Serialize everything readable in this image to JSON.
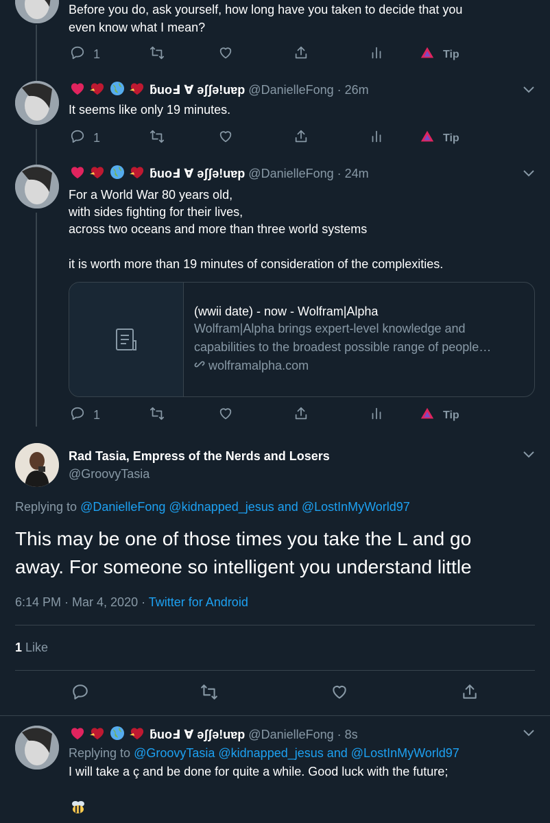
{
  "colors": {
    "background": "#15202b",
    "text": "#ffffff",
    "muted": "#8899a6",
    "accent": "#1da1f2",
    "border": "#38444d",
    "tip": "#e0245e"
  },
  "tweet0": {
    "text_line1": "Before you do, ask yourself, how long have you taken to  decide that you",
    "text_line2": "even know what I mean?",
    "reply_count": "1",
    "tip_label": "Tip"
  },
  "tweet1": {
    "display_name": "ƃuoℲ ∀ ǝʃʃǝ!uɐp",
    "handle_time": "@DanielleFong · 26m",
    "text": "It seems like only 19 minutes.",
    "reply_count": "1",
    "tip_label": "Tip"
  },
  "tweet2": {
    "display_name": "ƃuoℲ ∀ ǝʃʃǝ!uɐp",
    "handle_time": "@DanielleFong · 24m",
    "text_line1": "For a World War 80 years old,",
    "text_line2": "with sides fighting for their lives,",
    "text_line3": "across two oceans and more than three world systems",
    "text_line4": "it is worth more than 19 minutes of consideration of the complexities.",
    "card_title": "(wwii date) - now - Wolfram|Alpha",
    "card_desc1": "Wolfram|Alpha brings expert-level knowledge and",
    "card_desc2": "capabilities to the broadest possible range of people…",
    "card_domain": "wolframalpha.com",
    "reply_count": "1",
    "tip_label": "Tip"
  },
  "main_tweet": {
    "display_name": "Rad Tasia, Empress of the Nerds and Losers",
    "handle": "@GroovyTasia",
    "replying_prefix": "Replying to ",
    "replying_handles": "@DanielleFong @kidnapped_jesus and @LostInMyWorld97",
    "text_line1": "This may be one of those times you take the L and go",
    "text_line2": "away. For someone so intelligent you understand little",
    "timestamp": "6:14 PM · Mar 4, 2020 · ",
    "source": "Twitter for Android",
    "like_count": "1",
    "like_label": " Like"
  },
  "tweet3": {
    "display_name": "ƃuoℲ ∀ ǝʃʃǝ!uɐp",
    "handle_time": "@DanielleFong · 8s",
    "replying_prefix": "Replying to ",
    "replying_handles": "@GroovyTasia @kidnapped_jesus and @LostInMyWorld97",
    "text": "I will take a ç and be done for quite a while. Good luck with the future;"
  }
}
